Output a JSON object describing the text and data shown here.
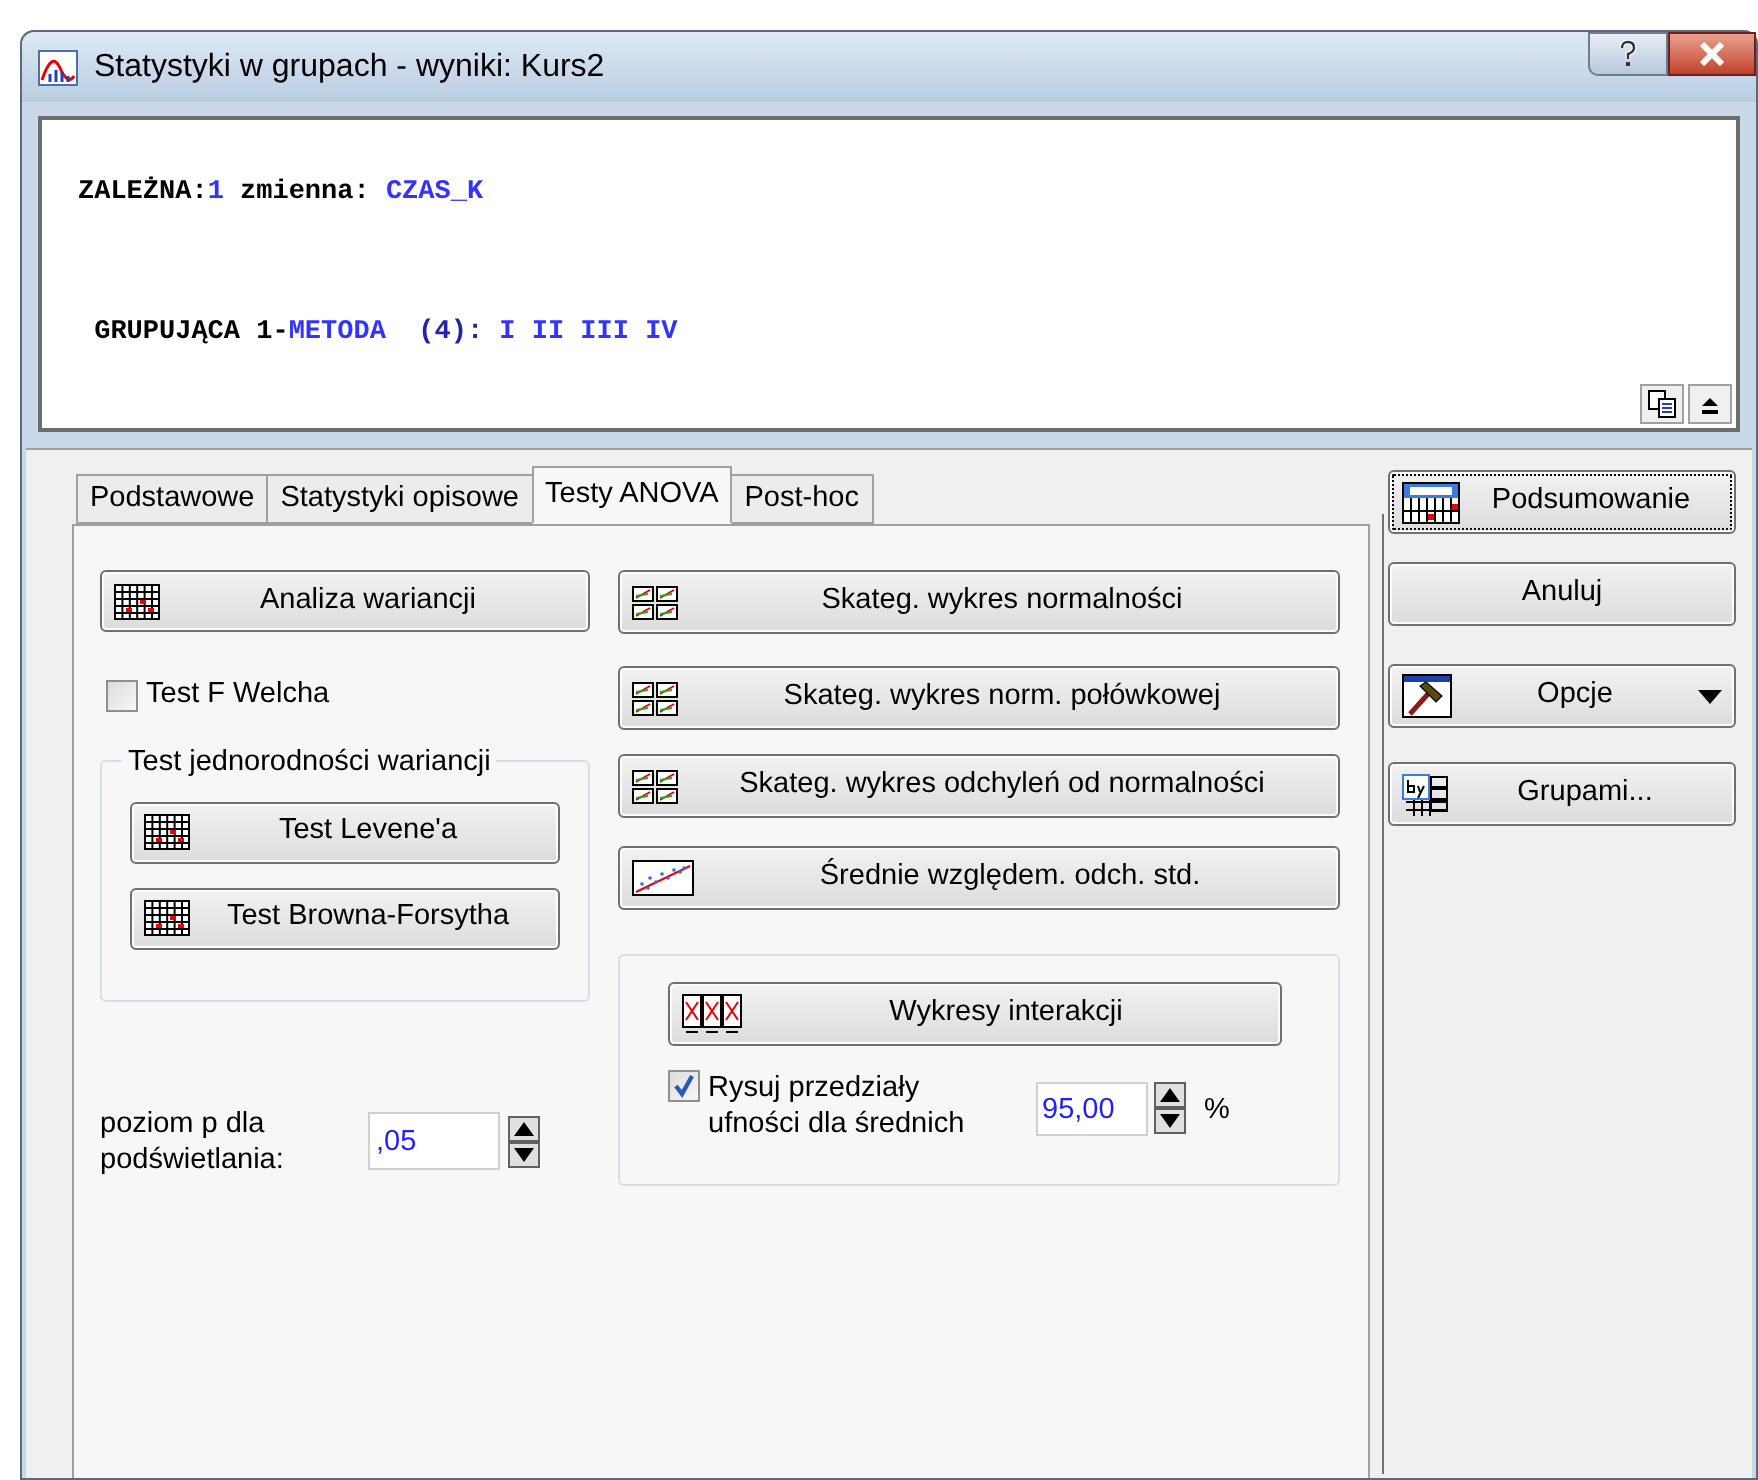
{
  "window": {
    "title": "Statystyki w grupach - wyniki: Kurs2"
  },
  "output": {
    "lines": [
      {
        "segments": [
          {
            "text": "ZALEŻNA:",
            "color": "#000000"
          },
          {
            "text": "1",
            "color": "#3333ff"
          },
          {
            "text": " zmienna: ",
            "color": "#000000"
          },
          {
            "text": "CZAS_K",
            "color": "#3333ff"
          }
        ]
      },
      {
        "segments": [
          {
            "text": " GRUPUJĄCA 1-",
            "color": "#000000"
          },
          {
            "text": "METODA",
            "color": "#3333ff"
          },
          {
            "text": "  (4): ",
            "color": "#2222aa"
          },
          {
            "text": "I II III IV",
            "color": "#3333ff"
          }
        ]
      }
    ]
  },
  "tabs": [
    {
      "label": "Podstawowe",
      "selected": false
    },
    {
      "label": "Statystyki opisowe",
      "selected": false
    },
    {
      "label": "Testy ANOVA",
      "selected": true
    },
    {
      "label": "Post-hoc",
      "selected": false
    }
  ],
  "anova_button": {
    "label": "Analiza wariancji"
  },
  "welch_checkbox": {
    "label": "Test F Welcha",
    "checked": false
  },
  "homogeneity_group": {
    "title": "Test jednorodności wariancji",
    "buttons": [
      "Test Levene'a",
      "Test Browna-Forsytha"
    ]
  },
  "p_level": {
    "label": "poziom p dla podświetlania:",
    "value": ",05"
  },
  "plot_buttons": [
    {
      "label": "Skateg. wykres normalności",
      "kind": "grid"
    },
    {
      "label": "Skateg. wykres norm. połówkowej",
      "kind": "grid"
    },
    {
      "label": "Skateg. wykres odchyleń od normalności",
      "kind": "grid"
    },
    {
      "label": "Średnie względem. odch. std.",
      "kind": "scatter"
    }
  ],
  "interaction_group": {
    "button": "Wykresy interakcji",
    "checkbox": {
      "label": "Rysuj przedziały ufności dla średnich",
      "checked": true
    },
    "value": "95,00",
    "unit": "%"
  },
  "side_buttons": [
    {
      "label": "Podsumowanie",
      "kind": "summary"
    },
    {
      "label": "Anuluj",
      "kind": "plain"
    },
    {
      "label": "Opcje",
      "kind": "options"
    },
    {
      "label": "Grupami...",
      "kind": "by"
    }
  ]
}
